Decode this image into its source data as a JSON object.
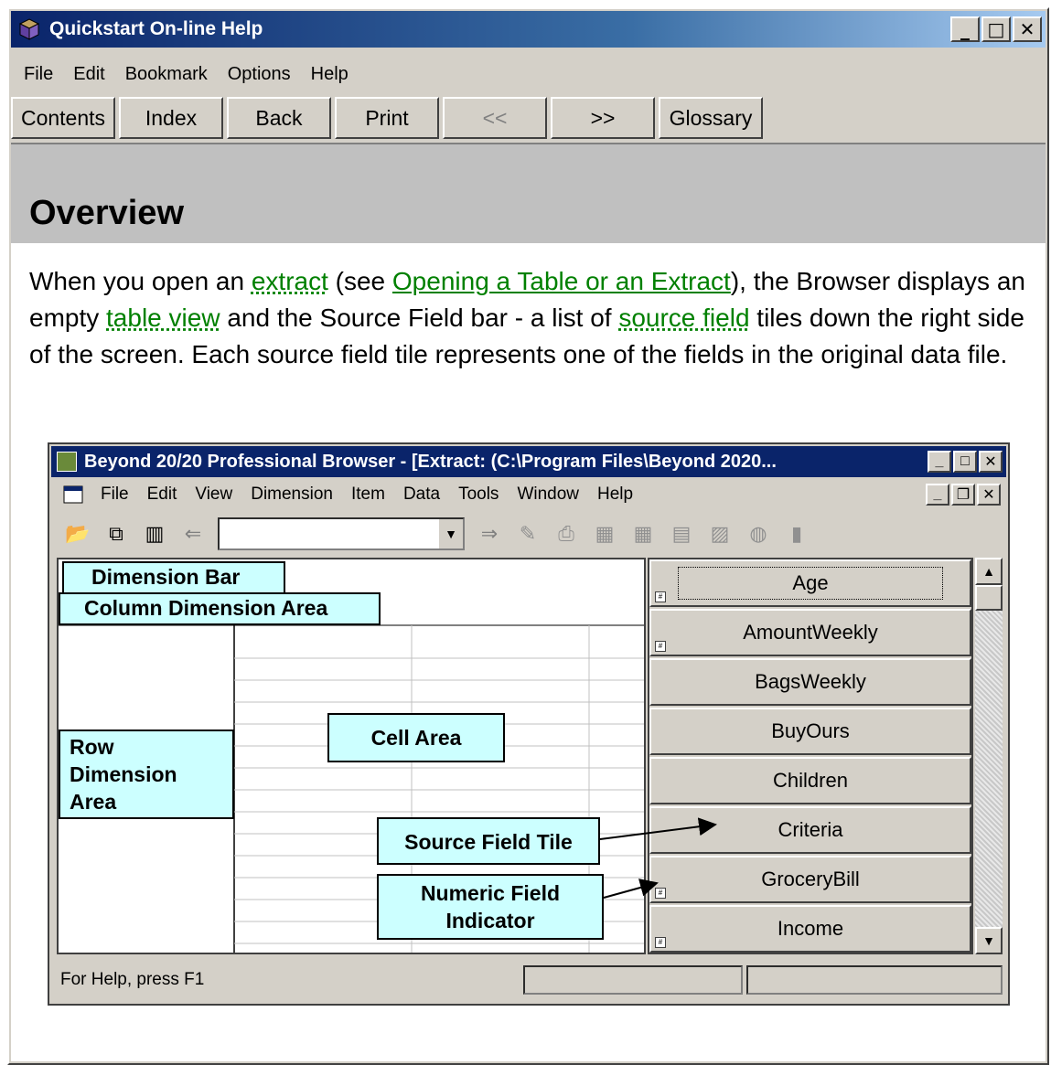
{
  "window": {
    "title": "Quickstart On-line Help",
    "controls": [
      "_",
      "□",
      "✕"
    ]
  },
  "menubar": [
    "File",
    "Edit",
    "Bookmark",
    "Options",
    "Help"
  ],
  "navbar": [
    "Contents",
    "Index",
    "Back",
    "Print",
    "<<",
    ">>",
    "Glossary"
  ],
  "page": {
    "heading": "Overview",
    "paragraph": {
      "p1": "When you open an ",
      "link1": "extract",
      "p2": " (see ",
      "link2": "Opening a Table or an Extract",
      "p3": "), the Browser displays an empty ",
      "link3": "table view",
      "p4": " and the Source Field bar - a list of ",
      "link4": "source field",
      "p5": " tiles down the right side of the screen. Each source field tile represents one of the fields in the original data file."
    }
  },
  "screenshot": {
    "title": "Beyond 20/20 Professional Browser - [Extract:  (C:\\Program Files\\Beyond 2020...",
    "menu": [
      "File",
      "Edit",
      "View",
      "Dimension",
      "Item",
      "Data",
      "Tools",
      "Window",
      "Help"
    ],
    "callouts": {
      "dimension_bar": "Dimension Bar",
      "column_dimension": "Column Dimension Area",
      "row_dimension": "Row Dimension Area",
      "cell_area": "Cell Area",
      "source_field_tile": "Source Field Tile",
      "numeric_field_indicator": "Numeric Field Indicator"
    },
    "tiles": [
      "Age",
      "AmountWeekly",
      "BagsWeekly",
      "BuyOurs",
      "Children",
      "Criteria",
      "GroceryBill",
      "Income"
    ],
    "status_text": "For Help, press F1"
  }
}
